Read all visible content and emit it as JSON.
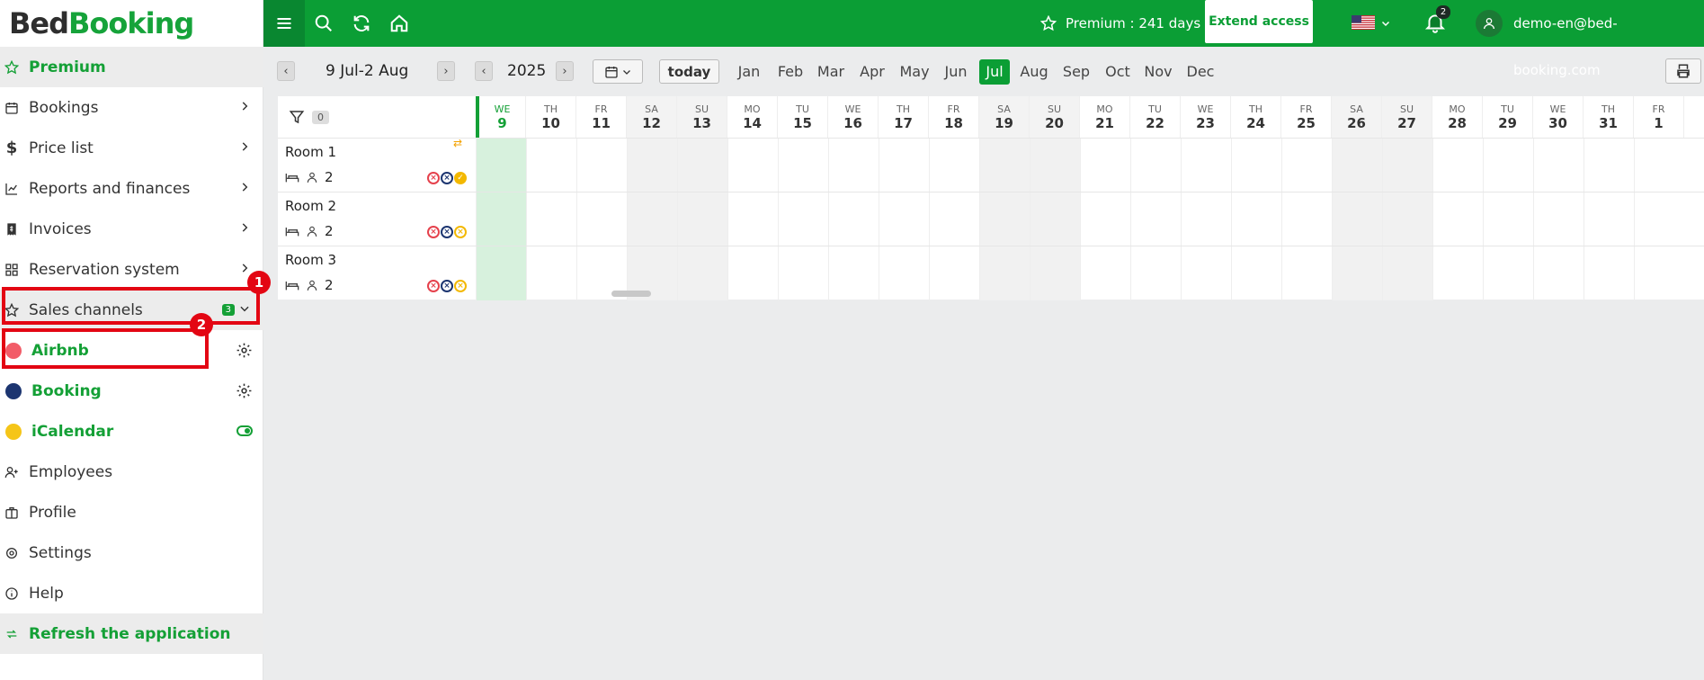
{
  "app": {
    "logo_part1": "Bed",
    "logo_part2": "Booking"
  },
  "sidebar": {
    "premium": "Premium",
    "items": [
      {
        "label": "Bookings",
        "icon": "calendar-icon"
      },
      {
        "label": "Price list",
        "icon": "dollar-icon"
      },
      {
        "label": "Reports and finances",
        "icon": "chart-icon"
      },
      {
        "label": "Invoices",
        "icon": "invoice-icon"
      },
      {
        "label": "Reservation system",
        "icon": "grid-icon"
      }
    ],
    "sales_channels": {
      "label": "Sales channels",
      "badge": "3"
    },
    "channels": [
      {
        "label": "Airbnb",
        "color": "#f25c68"
      },
      {
        "label": "Booking",
        "color": "#1c3570"
      },
      {
        "label": "iCalendar",
        "color": "#f5c518"
      }
    ],
    "bottom_items": [
      {
        "label": "Employees",
        "icon": "user-plus-icon"
      },
      {
        "label": "Profile",
        "icon": "briefcase-icon"
      },
      {
        "label": "Settings",
        "icon": "gear-icon"
      },
      {
        "label": "Help",
        "icon": "info-icon"
      }
    ],
    "refresh": "Refresh the application"
  },
  "markers": {
    "first": "1",
    "second": "2"
  },
  "topbar": {
    "premium_text": "Premium : 241 days",
    "extend_label": "Extend access",
    "notifications": "2",
    "user_email": "demo-en@bed-booking.com"
  },
  "toolbar": {
    "date_range": "9 Jul-2 Aug",
    "year": "2025",
    "today_label": "today",
    "months": [
      "Jan",
      "Feb",
      "Mar",
      "Apr",
      "May",
      "Jun",
      "Jul",
      "Aug",
      "Sep",
      "Oct",
      "Nov",
      "Dec"
    ],
    "active_month": "Jul"
  },
  "calendar": {
    "filter_count": "0",
    "days": [
      {
        "dw": "WE",
        "dn": "9"
      },
      {
        "dw": "TH",
        "dn": "10"
      },
      {
        "dw": "FR",
        "dn": "11"
      },
      {
        "dw": "SA",
        "dn": "12"
      },
      {
        "dw": "SU",
        "dn": "13"
      },
      {
        "dw": "MO",
        "dn": "14"
      },
      {
        "dw": "TU",
        "dn": "15"
      },
      {
        "dw": "WE",
        "dn": "16"
      },
      {
        "dw": "TH",
        "dn": "17"
      },
      {
        "dw": "FR",
        "dn": "18"
      },
      {
        "dw": "SA",
        "dn": "19"
      },
      {
        "dw": "SU",
        "dn": "20"
      },
      {
        "dw": "MO",
        "dn": "21"
      },
      {
        "dw": "TU",
        "dn": "22"
      },
      {
        "dw": "WE",
        "dn": "23"
      },
      {
        "dw": "TH",
        "dn": "24"
      },
      {
        "dw": "FR",
        "dn": "25"
      },
      {
        "dw": "SA",
        "dn": "26"
      },
      {
        "dw": "SU",
        "dn": "27"
      },
      {
        "dw": "MO",
        "dn": "28"
      },
      {
        "dw": "TU",
        "dn": "29"
      },
      {
        "dw": "WE",
        "dn": "30"
      },
      {
        "dw": "TH",
        "dn": "31"
      },
      {
        "dw": "FR",
        "dn": "1"
      }
    ],
    "rooms": [
      {
        "name": "Room 1",
        "guests": "2"
      },
      {
        "name": "Room 2",
        "guests": "2"
      },
      {
        "name": "Room 3",
        "guests": "2"
      }
    ]
  }
}
